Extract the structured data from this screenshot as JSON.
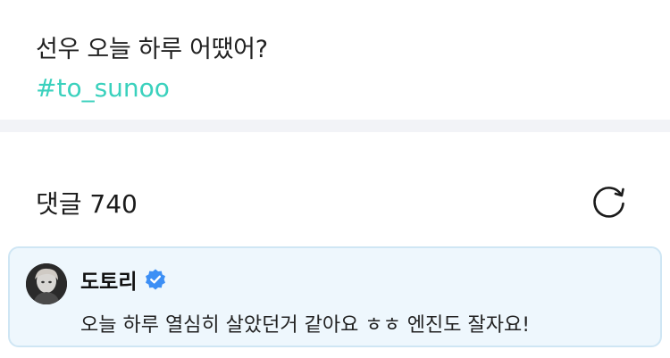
{
  "post": {
    "text": "선우 오늘 하루 어땠어?",
    "hashtag": "#to_sunoo"
  },
  "comments": {
    "label": "댓글 740",
    "refresh_icon": "refresh-icon"
  },
  "comment": {
    "author": "도토리",
    "verified_icon": "verified-badge-icon",
    "text": "오늘 하루 열심히 살았던거 같아요 ㅎㅎ 엔진도 잘자요!"
  },
  "colors": {
    "hashtag": "#3ad1bd",
    "card_bg": "#eef7fd",
    "card_border": "#cfe6f4",
    "verified": "#3c8ff5"
  }
}
